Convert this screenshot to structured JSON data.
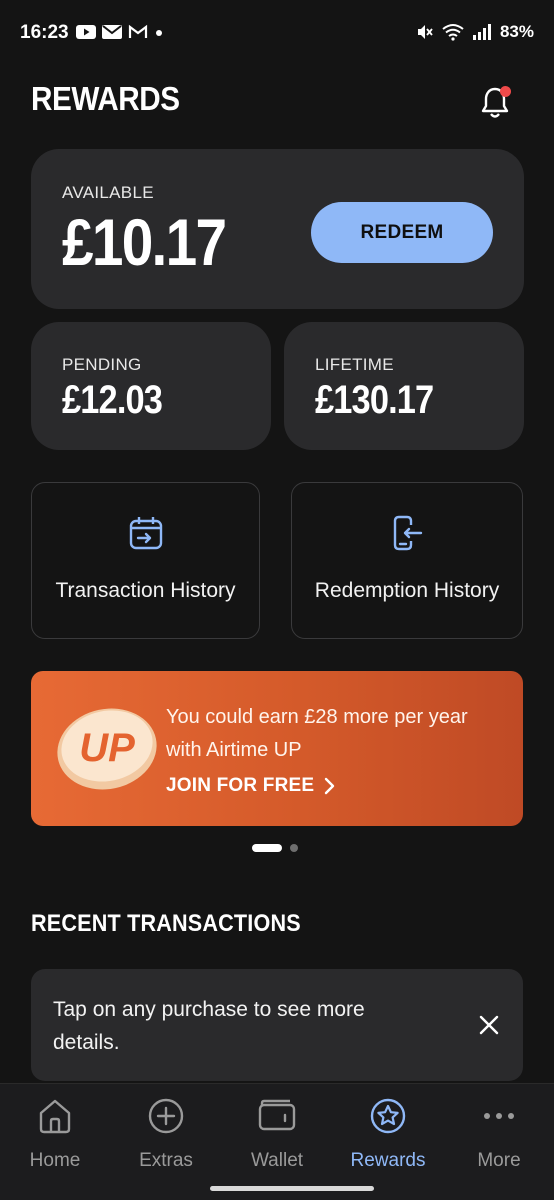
{
  "status_bar": {
    "time": "16:23",
    "battery": "83%",
    "network_label": "5",
    "notification_icons": [
      "youtube-icon",
      "gmail-icon",
      "gmail-outline-icon",
      "dot-icon"
    ]
  },
  "header": {
    "title": "REWARDS",
    "notifications_badge": true
  },
  "balances": {
    "available_label": "AVAILABLE",
    "available_amount": "£10.17",
    "redeem_label": "REDEEM",
    "pending_label": "PENDING",
    "pending_amount": "£12.03",
    "lifetime_label": "LIFETIME",
    "lifetime_amount": "£130.17"
  },
  "tiles": {
    "transaction_history": "Transaction History",
    "redemption_history": "Redemption History"
  },
  "promo": {
    "logo_text": "UP",
    "text": "You could earn £28 more per year with Airtime UP",
    "cta": "JOIN FOR FREE"
  },
  "carousel": {
    "page_count": 2,
    "active_index": 0
  },
  "recent": {
    "title": "RECENT TRANSACTIONS",
    "info": "Tap on any purchase to see more details."
  },
  "nav": {
    "items": [
      {
        "label": "Home",
        "icon": "home-icon"
      },
      {
        "label": "Extras",
        "icon": "plus-circle-icon"
      },
      {
        "label": "Wallet",
        "icon": "wallet-icon"
      },
      {
        "label": "Rewards",
        "icon": "star-circle-icon"
      },
      {
        "label": "More",
        "icon": "more-icon"
      }
    ],
    "active": "Rewards"
  },
  "colors": {
    "accent": "#8fb8f7",
    "background": "#141414",
    "card": "#2a2a2c",
    "promo": "#d45a2a",
    "badge": "#ef4a4a"
  }
}
